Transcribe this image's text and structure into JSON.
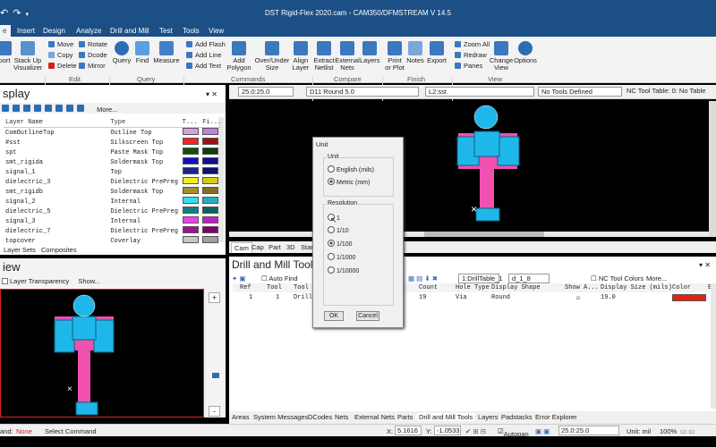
{
  "window": {
    "title": "DST Rigid-Flex 2020.cam - CAM350/DFMSTREAM V 14.5"
  },
  "menu": {
    "tabs": [
      "e",
      "Insert",
      "Design",
      "Analyze",
      "Drill and Mill",
      "Test",
      "Tools",
      "View"
    ]
  },
  "ribbon": {
    "stack": {
      "export": "port",
      "stackup": "Stack Up\nVisualizer"
    },
    "edit": {
      "move": "Move",
      "copy": "Copy",
      "delete": "Delete",
      "rotate": "Rotate",
      "dcode": "Dcode",
      "mirror": "Mirror",
      "group": "Edit"
    },
    "query": {
      "query": "Query",
      "find": "Find",
      "measure": "Measure",
      "group": "Query"
    },
    "add": {
      "flash": "Add Flash",
      "line": "Add Line",
      "text": "Add Text"
    },
    "commands": {
      "polygon": "Add\nPolygon",
      "overunder": "Over/Under\nSize",
      "align": "Align\nLayer",
      "group": "Commands"
    },
    "compare": {
      "netlist": "Extract\nNetlist",
      "external": "External\nNets",
      "layers": "Layers",
      "group": "Compare"
    },
    "finish": {
      "print": "Print\nor Plot",
      "notes": "Notes",
      "export": "Export",
      "group": "Finish"
    },
    "view": {
      "zoomall": "Zoom All",
      "redraw": "Redraw",
      "panes": "Panes",
      "change": "Change\nView",
      "options": "Options",
      "group": "View"
    }
  },
  "layer_panel": {
    "title": "splay",
    "more": "More...",
    "headers": [
      "Layer Name",
      "Type",
      "T...",
      "Fi..."
    ],
    "rows": [
      {
        "name": "ComOutlineTop",
        "type": "Outline Top",
        "c1": "#d8a0e8",
        "c2": "#c080e0"
      },
      {
        "name": "#sst",
        "type": "Silkscreen Top",
        "c1": "#ff2020",
        "c2": "#a01010"
      },
      {
        "name": "spt",
        "type": "Paste Mask Top",
        "c1": "#105010",
        "c2": "#0a4010"
      },
      {
        "name": "smt_rigida",
        "type": "Soldermask Top",
        "c1": "#1010c0",
        "c2": "#101090"
      },
      {
        "name": "signal_1",
        "type": "Top",
        "c1": "#202090",
        "c2": "#101070"
      },
      {
        "name": "dielectric_3",
        "type": "Dielectric PrePreg",
        "c1": "#f0f020",
        "c2": "#d0d010"
      },
      {
        "name": "smt_rigidb",
        "type": "Soldermask Top",
        "c1": "#a09030",
        "c2": "#807020"
      },
      {
        "name": "signal_2",
        "type": "Internal",
        "c1": "#30e0f0",
        "c2": "#20b0c0"
      },
      {
        "name": "dielectric_5",
        "type": "Dielectric PrePreg",
        "c1": "#108080",
        "c2": "#106060"
      },
      {
        "name": "signal_3",
        "type": "Internal",
        "c1": "#f040f0",
        "c2": "#c020c0"
      },
      {
        "name": "dielectric_7",
        "type": "Dielectric PrePreg",
        "c1": "#a01090",
        "c2": "#800070"
      },
      {
        "name": "topcover",
        "type": "Coverlay",
        "c1": "#c8c8c8",
        "c2": "#a0a0a0"
      }
    ],
    "footer_tabs": [
      "Layer Sets",
      "Composites"
    ]
  },
  "view_panel": {
    "title": "iew",
    "transparency": "Layer Transparency",
    "show": "Show..."
  },
  "editor_toolbar": {
    "zoom": "25.0:25.0",
    "dcode": "D11  Round 5.0",
    "layer": "L2:sst",
    "tools": "No Tools Defined",
    "nc": "NC Tool Table: 0: No Table"
  },
  "editor_tabs": [
    "Cam",
    "Cap",
    "Part",
    "3D",
    "Start"
  ],
  "drill_panel": {
    "title": "Drill and Mill Tools",
    "autofind": "Auto Find",
    "table_select": "1:DrillTable_1",
    "file": "d_1_8",
    "nc_colors": "NC Tool Colors",
    "more": "More...",
    "headers": [
      "Ref",
      "Tool",
      "Tool T",
      "Count",
      "Hole Type",
      "Display Shape",
      "Show A...",
      "Display Size (mils)",
      "Color",
      "Ex"
    ],
    "row": {
      "ref": "1",
      "tool": "1",
      "type": "Drill",
      "count": "19",
      "hole": "Via",
      "shape": "Round",
      "size": "19.0",
      "color": "#e82010"
    }
  },
  "bottom_tabs": [
    "Areas",
    "System Messages",
    "DCodes",
    "Nets",
    "External Nets",
    "Parts",
    "Drill and Mill Tools",
    "Layers",
    "Padstacks",
    "Error Explorer"
  ],
  "status": {
    "command_label": "and:",
    "command": "None",
    "prompt": "Select Command",
    "x_label": "X:",
    "x": "5.1616",
    "y_label": "Y:",
    "y": "-1.0533",
    "autopan": "Autopan",
    "zoom": "25.0:25.0",
    "unit": "Unit: mil",
    "percent": "100%"
  },
  "dialog": {
    "title": "Unit",
    "unit_legend": "Unit",
    "english": "English (mils)",
    "metric": "Metric (mm)",
    "res_legend": "Resolution",
    "res": [
      "1",
      "1/10",
      "1/100",
      "1/1000",
      "1/10000"
    ],
    "selected_res": "1/100",
    "ok": "OK",
    "cancel": "Cancel"
  },
  "colors": {
    "pcb_cyan": "#1fb7ea",
    "pcb_pink": "#f050b0",
    "ribbon_blue": "#1b4f86"
  }
}
